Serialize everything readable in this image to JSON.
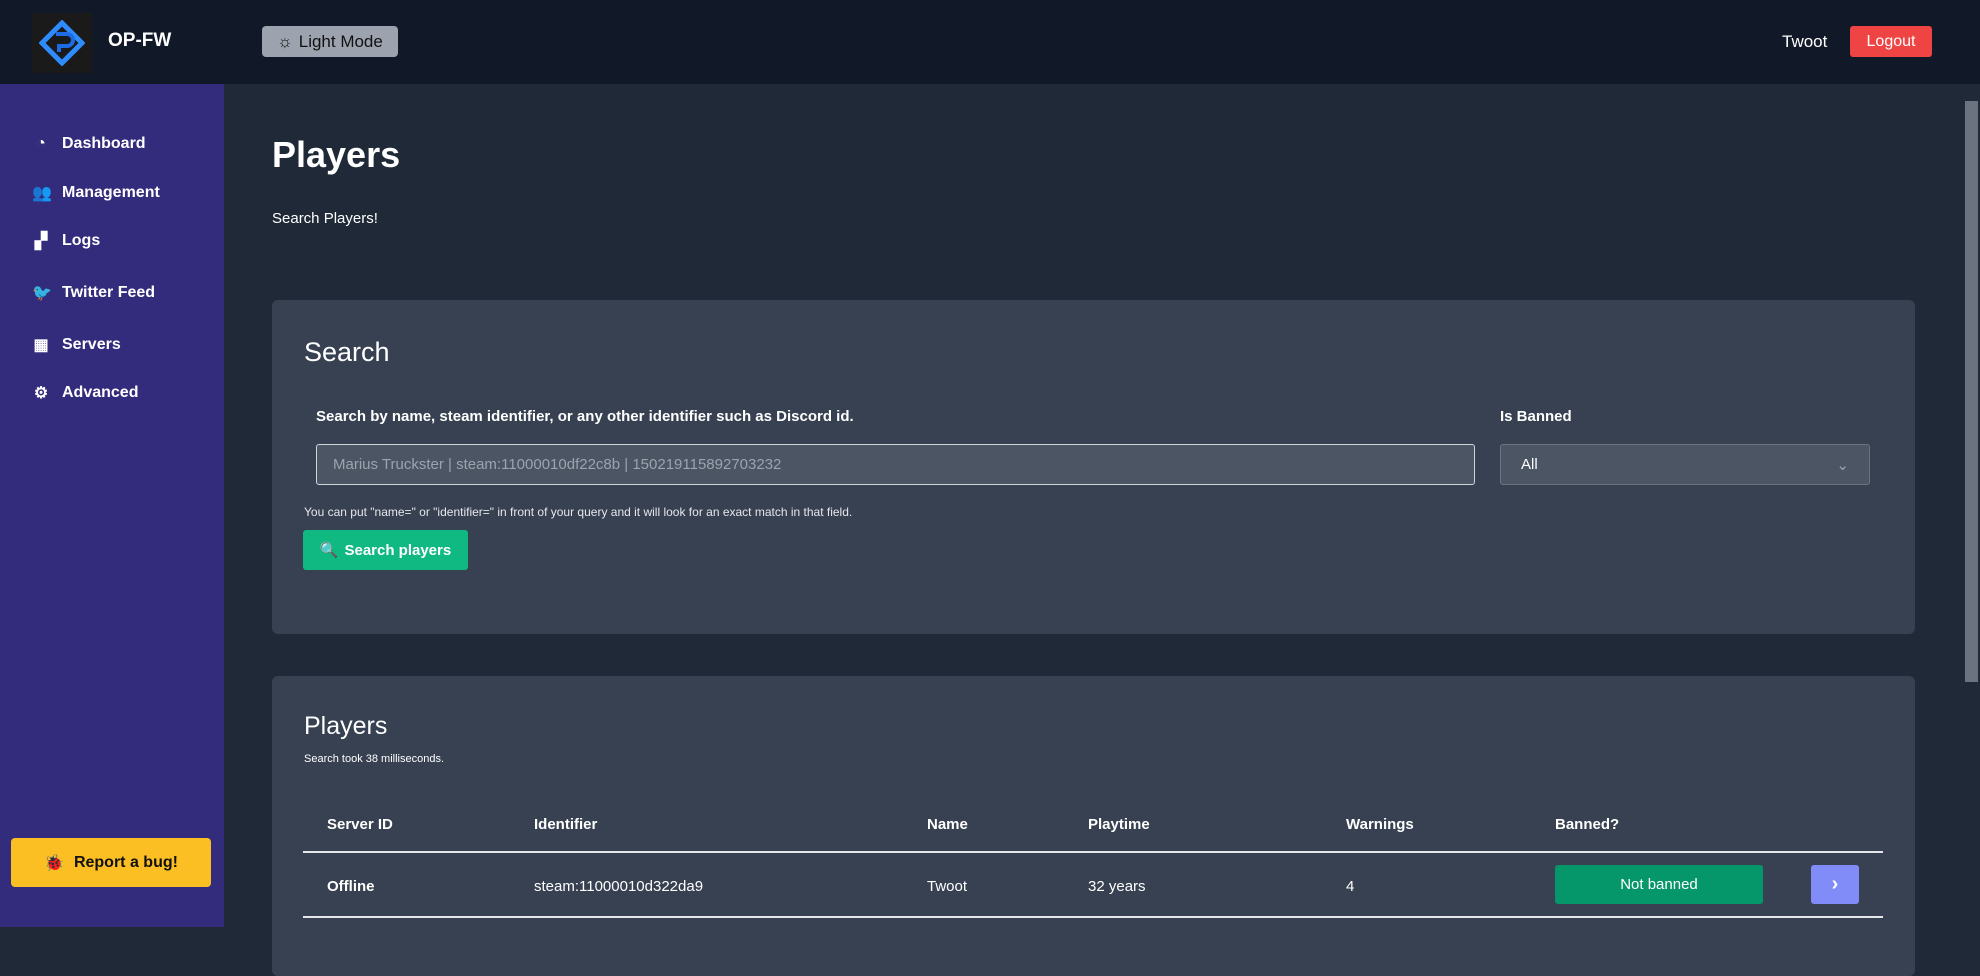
{
  "header": {
    "brand": "OP-FW",
    "theme_toggle": "Light Mode",
    "username": "Twoot",
    "logout": "Logout"
  },
  "sidebar": {
    "items": [
      {
        "label": "Dashboard",
        "icon": "gauge-icon"
      },
      {
        "label": "Management",
        "icon": "users-icon"
      },
      {
        "label": "Logs",
        "icon": "boxes-icon"
      },
      {
        "label": "Twitter Feed",
        "icon": "twitter-icon"
      },
      {
        "label": "Servers",
        "icon": "building-icon"
      },
      {
        "label": "Advanced",
        "icon": "gears-icon"
      }
    ],
    "report_bug": "Report a bug!"
  },
  "page": {
    "title": "Players",
    "subtitle": "Search Players!"
  },
  "search": {
    "title": "Search",
    "query_label": "Search by name, steam identifier, or any other identifier such as Discord id.",
    "query_placeholder": "Marius Truckster | steam:11000010df22c8b | 150219115892703232",
    "banned_label": "Is Banned",
    "banned_value": "All",
    "help": "You can put \"name=\" or \"identifier=\" in front of your query and it will look for an exact match in that field.",
    "button": "Search players"
  },
  "players": {
    "title": "Players",
    "timing": "Search took 38 milliseconds.",
    "columns": [
      "Server ID",
      "Identifier",
      "Name",
      "Playtime",
      "Warnings",
      "Banned?"
    ],
    "rows": [
      {
        "server_id": "Offline",
        "identifier": "steam:11000010d322da9",
        "name": "Twoot",
        "playtime": "32 years",
        "warnings": "4",
        "banned": "Not banned"
      }
    ]
  }
}
